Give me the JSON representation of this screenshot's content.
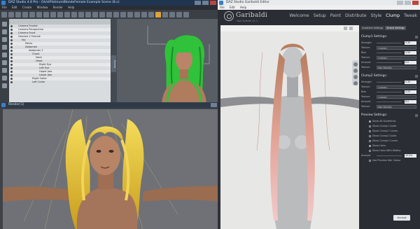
{
  "daz_window": {
    "title": "DAZ Studio 4.8 Pro - Gh/stPlatinumBlondeFemale Example Scene (8.x)",
    "menu": [
      "File",
      "Edit",
      "Create",
      "Window",
      "Render",
      "Help"
    ],
    "side_tab": "Scene"
  },
  "scene_tree": [
    {
      "label": "Camera Frontal",
      "indent": 1
    },
    {
      "label": "Camera Perspective",
      "indent": 1
    },
    {
      "label": "Camera Front",
      "indent": 1
    },
    {
      "label": "Genesis 2 Female",
      "indent": 1
    },
    {
      "label": "hip",
      "indent": 2
    },
    {
      "label": "Pelvis",
      "indent": 3
    },
    {
      "label": "Abdomen",
      "indent": 3
    },
    {
      "label": "Abdomen 2",
      "indent": 4
    },
    {
      "label": "Chest",
      "indent": 5
    },
    {
      "label": "Neck",
      "indent": 6
    },
    {
      "label": "Head",
      "indent": 6
    },
    {
      "label": "Right Eye",
      "indent": 7
    },
    {
      "label": "Left Eye",
      "indent": 7
    },
    {
      "label": "Upper Jaw",
      "indent": 7
    },
    {
      "label": "Lower Jaw",
      "indent": 7
    },
    {
      "label": "Right Collar",
      "indent": 5
    },
    {
      "label": "Left Collar",
      "indent": 5
    }
  ],
  "render_window": {
    "title": "Render(1)"
  },
  "garibaldi": {
    "title": "DAZ Studio Garibaldi Editor",
    "menu": [
      "File",
      "Edit",
      "Help"
    ],
    "brand": "Garibaldi",
    "subtitle": "Hair System v1.1",
    "nav": [
      "Welcome",
      "Setup",
      "Paint",
      "Distribute",
      "Style",
      "Clump",
      "Tweak"
    ],
    "active_nav": "Clump",
    "panel_tabs": [
      "Guideline Settings",
      "Strand Settings"
    ],
    "clump1": {
      "title": "Clump1 Settings:",
      "rows": [
        {
          "label": "Strength",
          "value": "0.30"
        },
        {
          "label": "Texture",
          "dropdown": "<none>"
        },
        {
          "label": "Bias",
          "value": "0.55"
        },
        {
          "label": "Texture",
          "dropdown": "<none>"
        },
        {
          "label": "Amount",
          "value": "6.0"
        },
        {
          "label": "Texture",
          "dropdown": "Hair Density"
        }
      ]
    },
    "clump2": {
      "title": "Clump2 Settings:",
      "rows": [
        {
          "label": "Strength",
          "value": "0.30"
        },
        {
          "label": "Texture",
          "dropdown": "<none>"
        },
        {
          "label": "Bias",
          "value": "0.55"
        },
        {
          "label": "Texture",
          "dropdown": "<none>"
        },
        {
          "label": "Amount",
          "value": "6.0"
        },
        {
          "label": "Texture",
          "dropdown": "Hair Density"
        }
      ]
    },
    "preview": {
      "title": "Preview Settings:",
      "checks": [
        {
          "label": "Show All Guidelines",
          "on": true
        },
        {
          "label": "Show Clump1 Guide",
          "on": false
        },
        {
          "label": "Show Clump1 Curves",
          "on": false
        },
        {
          "label": "Show Clump2 Guide",
          "on": false
        },
        {
          "label": "Show Clump2 Curves",
          "on": false
        },
        {
          "label": "Show Hairs",
          "on": true
        },
        {
          "label": "Show Hairs With Widths",
          "on": false
        }
      ],
      "amount_label": "Amount",
      "amount_value": "10.0%",
      "use_preview_label": "Use Preview Hair Colour"
    },
    "ok_label": "Accept"
  },
  "colors": {
    "green_hair": "#2fc23a",
    "blonde_hair": "#e8c433",
    "pink_hair": "#e2a7a6",
    "accent": "#e0a23a"
  }
}
